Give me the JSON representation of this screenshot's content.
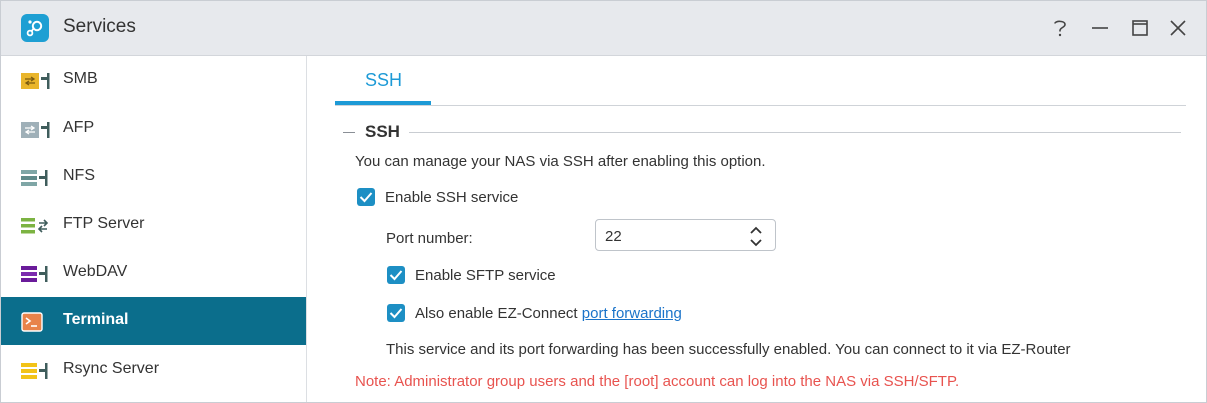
{
  "window": {
    "title": "Services",
    "icon": "services-app-icon",
    "controls": [
      "help-icon",
      "minimize-icon",
      "maximize-icon",
      "close-icon"
    ]
  },
  "sidebar": {
    "items": [
      {
        "label": "SMB",
        "icon": "smb-folder-icon",
        "color": "#e9b52b"
      },
      {
        "label": "AFP",
        "icon": "afp-folder-icon",
        "color": "#8fa3ad"
      },
      {
        "label": "NFS",
        "icon": "nfs-icon",
        "color": "#5f8a8a"
      },
      {
        "label": "FTP Server",
        "icon": "ftp-icon",
        "color": "#7cb342"
      },
      {
        "label": "WebDAV",
        "icon": "webdav-icon",
        "color": "#6a1b9a"
      },
      {
        "label": "Terminal",
        "icon": "terminal-icon",
        "color": "#e8834a",
        "active": true
      },
      {
        "label": "Rsync Server",
        "icon": "rsync-icon",
        "color": "#f2c318"
      }
    ]
  },
  "tabs": [
    {
      "label": "SSH",
      "active": true
    }
  ],
  "ssh": {
    "section_title": "SSH",
    "description": "You can manage your NAS via SSH after enabling this option.",
    "enable_ssh_label": "Enable SSH service",
    "enable_ssh_checked": true,
    "port_label": "Port number:",
    "port_value": "22",
    "enable_sftp_label": "Enable SFTP service",
    "enable_sftp_checked": true,
    "ez_connect_label": "Also enable EZ-Connect ",
    "ez_connect_link": "port forwarding",
    "ez_connect_checked": true,
    "status_text": "This service and its port forwarding has been successfully enabled. You can connect to it via EZ-Router",
    "note": "Note: Administrator group users and the [root] account can log into the NAS via SSH/SFTP."
  },
  "colors": {
    "accent": "#1d9ad6",
    "active_sidebar": "#0b6e8c",
    "note": "#e8534f",
    "link": "#1a73c9"
  }
}
